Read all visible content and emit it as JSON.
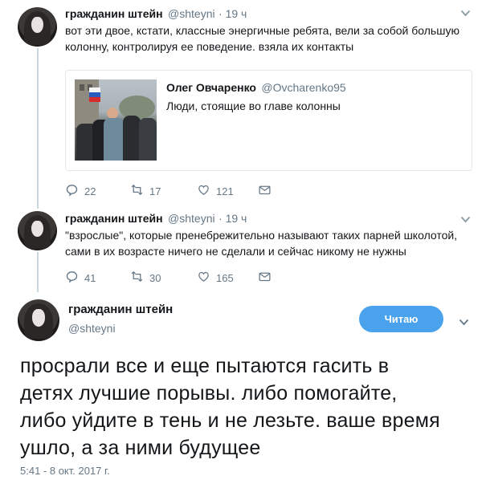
{
  "tweet1": {
    "name": "гражданин штейн",
    "handle": "@shteyni",
    "time": "· 19 ч",
    "text_line1": "вот эти двое, кстати, классные энергичные ребята, вели за собой большую",
    "text_line2": "колонну, контролируя ее поведение. взяла их контакты",
    "quote": {
      "name": "Олег Овчаренко",
      "handle": "@Ovcharenko95",
      "text": "Люди, стоящие во главе колонны"
    },
    "replies": "22",
    "retweets": "17",
    "likes": "121"
  },
  "tweet2": {
    "name": "гражданин штейн",
    "handle": "@shteyni",
    "time": "· 19 ч",
    "text_line1": "\"взрослые\", которые пренебрежительно называют таких парней школотой,",
    "text_line2": "сами в их возрасте ничего не сделали и сейчас никому не нужны",
    "replies": "41",
    "retweets": "30",
    "likes": "165"
  },
  "main_tweet": {
    "name": "гражданин штейн",
    "handle": "@shteyni",
    "follow_label": "Читаю",
    "line1": "просрали все и еще пытаются гасить в",
    "line2": "детях лучшие порывы. либо помогайте,",
    "line3": "либо уйдите в тень и не лезьте. ваше время",
    "line4": "ушло, а за ними будущее",
    "timestamp": "5:41 - 8 окт. 2017 г."
  },
  "colors": {
    "accent": "#4aa1ec",
    "secondary_text": "#657786",
    "thread_line": "#ccd6dd"
  },
  "icons": [
    "reply-icon",
    "retweet-icon",
    "like-icon",
    "message-icon",
    "chevron-down-icon"
  ]
}
